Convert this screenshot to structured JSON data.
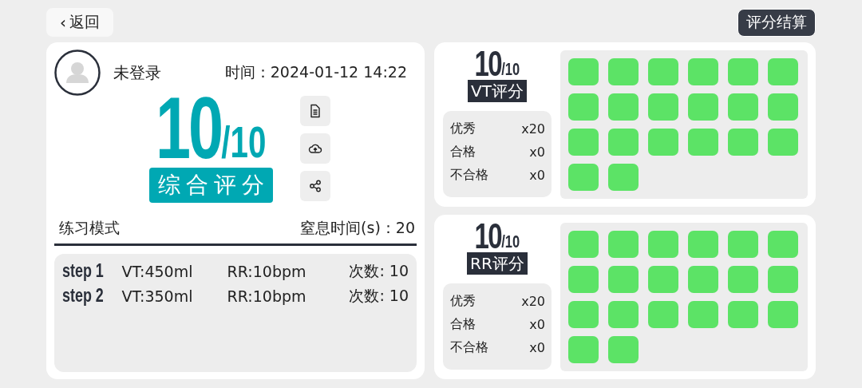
{
  "back_button": {
    "icon": "‹",
    "label": "返回"
  },
  "settle_button": {
    "label": "评分结算"
  },
  "summary": {
    "user": "未登录",
    "time_label": "时间：",
    "time": "2024-01-12 14:22",
    "score": "10",
    "max": "/10",
    "score_label": "综合评分",
    "mode": "练习模式",
    "apnea_label": "窒息时间(s)：",
    "apnea": "20",
    "steps": [
      {
        "name": "step 1",
        "vt": "VT:450ml",
        "rr": "RR:10bpm",
        "count": "次数: 10"
      },
      {
        "name": "step 2",
        "vt": "VT:350ml",
        "rr": "RR:10bpm",
        "count": "次数: 10"
      }
    ]
  },
  "panels": [
    {
      "score": "10",
      "max": "/10",
      "label": "VT评分",
      "stats": [
        {
          "label": "优秀",
          "value": "x20"
        },
        {
          "label": "合格",
          "value": "x0"
        },
        {
          "label": "不合格",
          "value": "x0"
        }
      ],
      "cells": [
        {
          "color": "#5ce366"
        },
        {
          "color": "#5ce366"
        },
        {
          "color": "#5ce366"
        },
        {
          "color": "#5ce366"
        },
        {
          "color": "#5ce366"
        },
        {
          "color": "#5ce366"
        },
        {
          "color": "#5ce366"
        },
        {
          "color": "#5ce366"
        },
        {
          "color": "#5ce366"
        },
        {
          "color": "#5ce366"
        },
        {
          "color": "#5ce366"
        },
        {
          "color": "#5ce366"
        },
        {
          "color": "#5ce366"
        },
        {
          "color": "#5ce366"
        },
        {
          "color": "#5ce366"
        },
        {
          "color": "#5ce366"
        },
        {
          "color": "#5ce366"
        },
        {
          "color": "#5ce366"
        },
        {
          "color": "#5ce366"
        },
        {
          "color": "#5ce366"
        }
      ]
    },
    {
      "score": "10",
      "max": "/10",
      "label": "RR评分",
      "stats": [
        {
          "label": "优秀",
          "value": "x20"
        },
        {
          "label": "合格",
          "value": "x0"
        },
        {
          "label": "不合格",
          "value": "x0"
        }
      ],
      "cells": [
        {
          "color": "#5ce366"
        },
        {
          "color": "#5ce366"
        },
        {
          "color": "#5ce366"
        },
        {
          "color": "#5ce366"
        },
        {
          "color": "#5ce366"
        },
        {
          "color": "#5ce366"
        },
        {
          "color": "#5ce366"
        },
        {
          "color": "#5ce366"
        },
        {
          "color": "#5ce366"
        },
        {
          "color": "#5ce366"
        },
        {
          "color": "#5ce366"
        },
        {
          "color": "#5ce366"
        },
        {
          "color": "#5ce366"
        },
        {
          "color": "#5ce366"
        },
        {
          "color": "#5ce366"
        },
        {
          "color": "#5ce366"
        },
        {
          "color": "#5ce366"
        },
        {
          "color": "#5ce366"
        },
        {
          "color": "#5ce366"
        },
        {
          "color": "#5ce366"
        }
      ]
    }
  ]
}
